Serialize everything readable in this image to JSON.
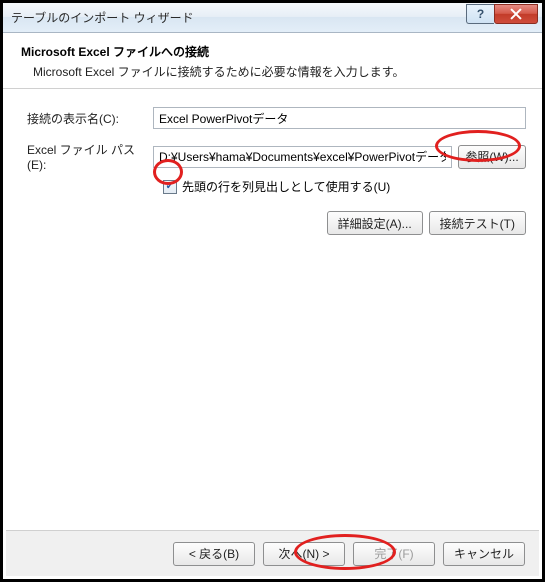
{
  "window": {
    "title": "テーブルのインポート ウィザード"
  },
  "header": {
    "title": "Microsoft Excel ファイルへの接続",
    "description": "Microsoft Excel ファイルに接続するために必要な情報を入力します。"
  },
  "form": {
    "friendly_name_label": "接続の表示名(C):",
    "friendly_name_value": "Excel PowerPivotデータ",
    "file_path_label": "Excel ファイル パス(E):",
    "file_path_value": "D:¥Users¥hama¥Documents¥excel¥PowerPivotデータ.xlsx",
    "browse_label": "参照(W)...",
    "use_first_row_label": "先頭の行を列見出しとして使用する(U)",
    "use_first_row_checked": true,
    "advanced_label": "詳細設定(A)...",
    "test_connection_label": "接続テスト(T)"
  },
  "footer": {
    "back_label": "< 戻る(B)",
    "next_label": "次へ(N) >",
    "finish_label": "完了(F)",
    "cancel_label": "キャンセル"
  }
}
